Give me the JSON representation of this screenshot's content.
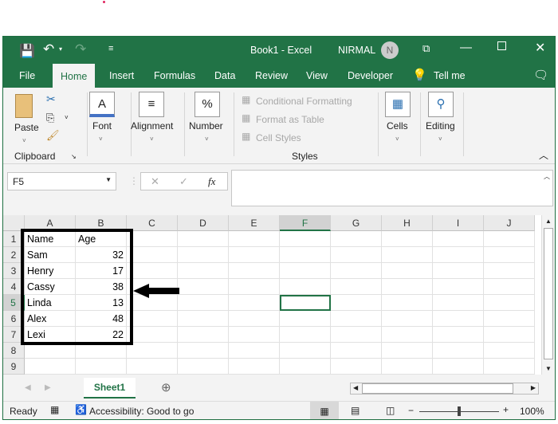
{
  "window": {
    "title": "Book1 - Excel",
    "user": "NIRMAL",
    "avatar_initial": "N"
  },
  "tabs": [
    "File",
    "Home",
    "Insert",
    "Formulas",
    "Data",
    "Review",
    "View",
    "Developer",
    "Tell me"
  ],
  "ribbon": {
    "clipboard": {
      "paste": "Paste",
      "group": "Clipboard"
    },
    "font": "Font",
    "alignment": "Alignment",
    "number": "Number",
    "number_glyph": "%",
    "styles": {
      "conditional": "Conditional Formatting",
      "table": "Format as Table",
      "cell_styles": "Cell Styles",
      "group": "Styles"
    },
    "cells": "Cells",
    "editing": "Editing"
  },
  "formula_bar": {
    "name_box": "F5",
    "fx": "fx",
    "value": ""
  },
  "columns": [
    "A",
    "B",
    "C",
    "D",
    "E",
    "F",
    "G",
    "H",
    "I",
    "J"
  ],
  "rows": [
    "1",
    "2",
    "3",
    "4",
    "5",
    "6",
    "7",
    "8",
    "9"
  ],
  "cells": [
    [
      "Name",
      "Age"
    ],
    [
      "Sam",
      "32"
    ],
    [
      "Henry",
      "17"
    ],
    [
      "Cassy",
      "38"
    ],
    [
      "Linda",
      "13"
    ],
    [
      "Alex",
      "48"
    ],
    [
      "Lexi",
      "22"
    ]
  ],
  "selected_cell": "F5",
  "sheets": [
    "Sheet1"
  ],
  "status": {
    "ready": "Ready",
    "accessibility": "Accessibility: Good to go",
    "zoom": "100%",
    "zoom_minus": "−",
    "zoom_plus": "+"
  }
}
